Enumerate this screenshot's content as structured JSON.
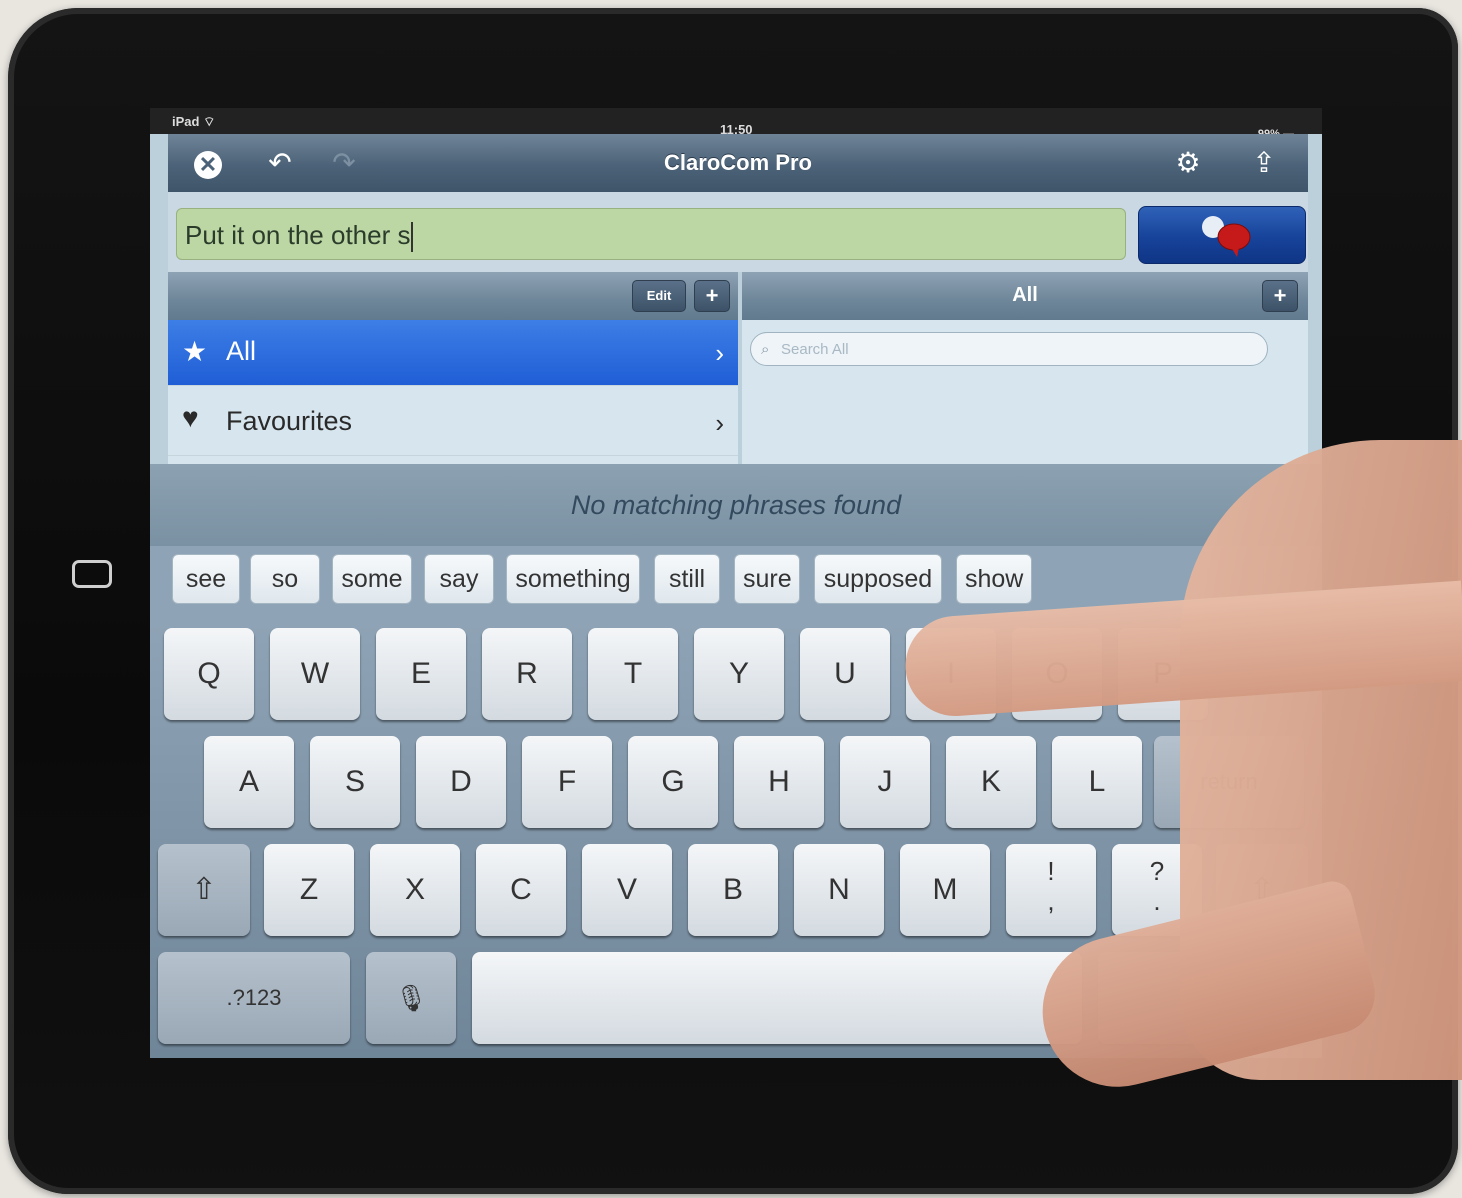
{
  "status": {
    "carrier": "iPad ⌔",
    "time": "11:50",
    "battery": "99% ▬"
  },
  "nav": {
    "title": "ClaroCom Pro",
    "undo": "↶",
    "redo": "↷",
    "settings": "⚙",
    "share": "⇪",
    "close": "✕"
  },
  "message": {
    "text": "Put it on the other s"
  },
  "categories": {
    "edit_label": "Edit",
    "add_label": "+",
    "items": [
      {
        "icon": "★",
        "label": "All",
        "chevron": "›"
      },
      {
        "icon": "♥",
        "label": "Favourites",
        "chevron": "›"
      }
    ]
  },
  "phrases": {
    "title": "All",
    "add_label": "+",
    "search_placeholder": "Search All",
    "search_icon": "⌕"
  },
  "no_match": "No matching phrases found",
  "suggestions": [
    "see",
    "so",
    "some",
    "say",
    "something",
    "still",
    "sure",
    "supposed",
    "show"
  ],
  "keyboard": {
    "row1": [
      "Q",
      "W",
      "E",
      "R",
      "T",
      "Y",
      "U",
      "I",
      "O",
      "P"
    ],
    "row2": [
      "A",
      "S",
      "D",
      "F",
      "G",
      "H",
      "J",
      "K",
      "L"
    ],
    "return": "return",
    "row3": [
      "Z",
      "X",
      "C",
      "V",
      "B",
      "N",
      "M"
    ],
    "shift": "⇧",
    "excl": "!\n,",
    "quest": "?\n.",
    "numbers": ".?123",
    "mic": "🎙"
  }
}
